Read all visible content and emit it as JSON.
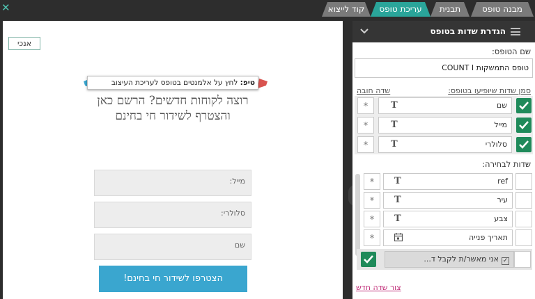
{
  "tabs": [
    {
      "label": "מבנה טופס"
    },
    {
      "label": "תבנית"
    },
    {
      "label": "עריכת טופס"
    },
    {
      "label": "קוד לייצוא"
    }
  ],
  "canvas": {
    "me_button": "אנכי",
    "tip_bold": "טיפ:",
    "tip_text": " לחץ על אלמנטים בטופס לעריכת העיצוב",
    "headline": "רוצה לקוחות חדשים? הרשם כאן והצטרף לשידור חי בחינם",
    "fields": [
      {
        "placeholder": "מייל:"
      },
      {
        "placeholder": "סלולרי:"
      },
      {
        "placeholder": "שם"
      }
    ],
    "submit_label": "הצטרפו לשידור חי בחינם!"
  },
  "panel": {
    "title": "הגדרת שדות בטופס",
    "form_name_label": "שם הטופס:",
    "form_name_value": "טופס התמשקות  COUNT I",
    "mark_fields_label": "סמן שדות שיופיעו בטופס:",
    "required_field_label": "שדה חובה",
    "selected_fields": [
      {
        "label": "שם"
      },
      {
        "label": "מייל"
      },
      {
        "label": "סלולרי"
      }
    ],
    "optional_label": "שדות לבחירה:",
    "optional_fields": [
      {
        "label": "ref",
        "icon": "T"
      },
      {
        "label": "עיר",
        "icon": "T"
      },
      {
        "label": "צבע",
        "icon": "T"
      },
      {
        "label": "תאריך פנייה",
        "icon": "calendar"
      }
    ],
    "consent_label": "אני מאשר/ת לקבל ד...",
    "create_field_link": "צור שדה חדש",
    "star": "*",
    "text_icon": "T"
  },
  "colors": {
    "active_tab": "#2aa59a",
    "check_green": "#1f8a5a",
    "submit_blue": "#3aa6cf",
    "link_pink": "#c1307a"
  }
}
